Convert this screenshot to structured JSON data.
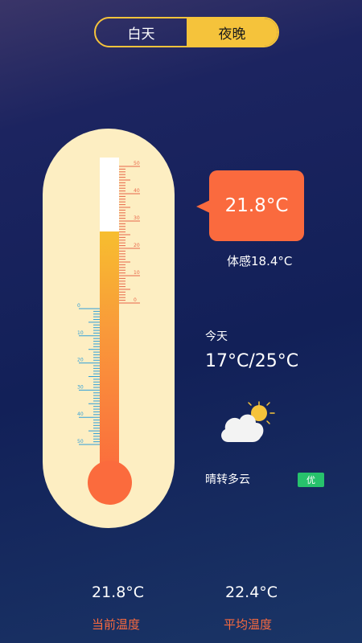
{
  "mode_toggle": {
    "day_label": "白天",
    "night_label": "夜晚",
    "selected": "夜晚"
  },
  "thermometer": {
    "right_scale_labels": [
      "50",
      "40",
      "30",
      "20",
      "10",
      "0"
    ],
    "left_scale_labels": [
      "0",
      "10",
      "20",
      "30",
      "40",
      "50"
    ],
    "level_celsius": 21.8,
    "right_scale_color": "#e8674a",
    "left_scale_color": "#2f9fd9"
  },
  "current": {
    "temperature": "21.8°C",
    "feels_like": "体感18.4°C"
  },
  "today": {
    "label": "今天",
    "range": "17°C/25°C",
    "condition": "晴转多云",
    "icon": "partly-cloudy-icon",
    "air_quality": "优",
    "air_quality_color": "#27c26c"
  },
  "summary": {
    "current_value": "21.8°C",
    "current_label": "当前温度",
    "average_value": "22.4°C",
    "average_label": "平均温度"
  },
  "colors": {
    "accent_yellow": "#f5c33b",
    "accent_orange": "#fa6a3e",
    "card_bg": "#fdeec2"
  }
}
